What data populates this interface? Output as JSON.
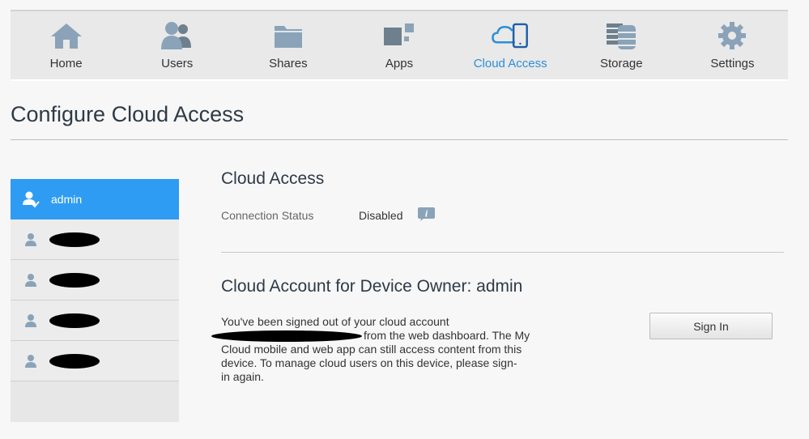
{
  "nav": {
    "items": [
      {
        "label": "Home",
        "icon": "home-icon"
      },
      {
        "label": "Users",
        "icon": "users-icon"
      },
      {
        "label": "Shares",
        "icon": "folder-icon"
      },
      {
        "label": "Apps",
        "icon": "apps-icon"
      },
      {
        "label": "Cloud Access",
        "icon": "cloud-device-icon",
        "active": true
      },
      {
        "label": "Storage",
        "icon": "storage-icon"
      },
      {
        "label": "Settings",
        "icon": "gear-icon"
      }
    ]
  },
  "page": {
    "title": "Configure Cloud Access"
  },
  "sidebar": {
    "users": [
      {
        "name": "admin",
        "active": true
      },
      {
        "name": "",
        "redacted": true
      },
      {
        "name": "",
        "redacted": true
      },
      {
        "name": "",
        "redacted": true
      },
      {
        "name": "",
        "redacted": true
      }
    ]
  },
  "cloud_access": {
    "title": "Cloud Access",
    "status_label": "Connection Status",
    "status_value": "Disabled"
  },
  "cloud_account": {
    "title": "Cloud Account for Device Owner: admin",
    "lines": [
      "You've been signed out of your cloud account",
      "from the web dashboard. The My",
      "Cloud mobile and web app can still access content from this",
      "device. To manage cloud users on this device, please sign-",
      "in again."
    ],
    "signin_label": "Sign In"
  },
  "colors": {
    "accent": "#2b8fd8",
    "selected": "#2f9cf3",
    "icon_gray": "#7f96a8"
  }
}
